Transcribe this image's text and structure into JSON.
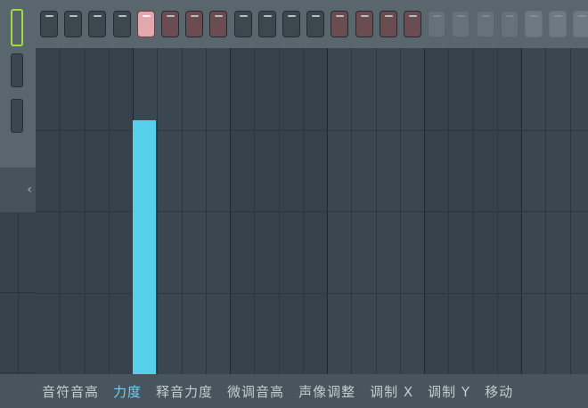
{
  "step_sequencer": {
    "buttons": [
      {
        "state": "off"
      },
      {
        "state": "off"
      },
      {
        "state": "off"
      },
      {
        "state": "off"
      },
      {
        "state": "lit"
      },
      {
        "state": "red"
      },
      {
        "state": "red"
      },
      {
        "state": "red"
      },
      {
        "state": "off"
      },
      {
        "state": "off"
      },
      {
        "state": "off"
      },
      {
        "state": "off"
      },
      {
        "state": "red"
      },
      {
        "state": "red"
      },
      {
        "state": "red"
      },
      {
        "state": "red"
      },
      {
        "state": "dim"
      },
      {
        "state": "dim"
      },
      {
        "state": "dim"
      },
      {
        "state": "dim"
      },
      {
        "state": "ghost"
      },
      {
        "state": "ghost"
      },
      {
        "state": "ghost"
      },
      {
        "state": "ghost"
      }
    ]
  },
  "left_strip": {
    "toggles": [
      {
        "state": "active"
      },
      {
        "state": "off"
      },
      {
        "state": "off"
      }
    ],
    "scroll_glyph": "‹"
  },
  "event_editor": {
    "selected_parameter": "力度",
    "notes": [
      {
        "bar": 2,
        "step": 1,
        "velocity": 0.78
      }
    ]
  },
  "tabs": [
    {
      "label": "音符音高",
      "active": false
    },
    {
      "label": "力度",
      "active": true
    },
    {
      "label": "释音力度",
      "active": false
    },
    {
      "label": "微调音高",
      "active": false
    },
    {
      "label": "声像调整",
      "active": false
    },
    {
      "label": "调制 X",
      "active": false
    },
    {
      "label": "调制 Y",
      "active": false
    },
    {
      "label": "移动",
      "active": false
    }
  ],
  "colors": {
    "accent": "#55cfea",
    "step_lit": "#e2a8ad",
    "step_red": "#6b4c50",
    "active_toggle": "#9ddc42",
    "active_tab": "#6fd0ef"
  }
}
